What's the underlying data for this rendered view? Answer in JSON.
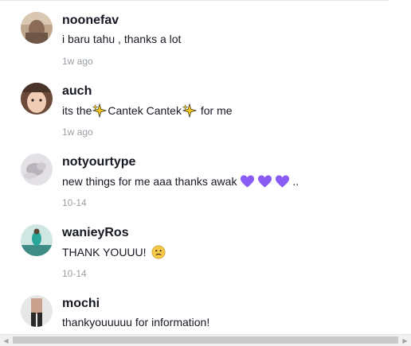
{
  "comments": [
    {
      "username": "noonefav",
      "text": "i baru tahu , thanks a lot",
      "date": "1w ago",
      "avatar": "avatar-noonefav"
    },
    {
      "username": "auch",
      "text_prefix": "its the ",
      "text_highlight": "Cantek Cantek",
      "text_suffix": " for me",
      "date": "1w ago",
      "avatar": "avatar-auch",
      "icons": [
        "sparkles-icon",
        "sparkles-icon"
      ]
    },
    {
      "username": "notyourtype",
      "text": "new things for me aaa thanks awak ",
      "text_trail": "..",
      "date": "10-14",
      "avatar": "avatar-notyourtype",
      "icons": [
        "purple-heart-icon",
        "purple-heart-icon",
        "purple-heart-icon"
      ]
    },
    {
      "username": "wanieyRos",
      "text": "THANK YOUUU!",
      "date": "10-14",
      "avatar": "avatar-wanieyros",
      "icons": [
        "slightly-frowning-face-icon"
      ]
    },
    {
      "username": "mochi",
      "text": "thankyouuuuu for information!",
      "avatar": "avatar-mochi"
    }
  ],
  "colors": {
    "text": "#161823",
    "date": "#9aa0a6",
    "heart": "#8a5cf6",
    "sparkle": "#f5c518"
  },
  "scrollbar": {
    "left_arrow": "◀",
    "right_arrow": "▶"
  }
}
